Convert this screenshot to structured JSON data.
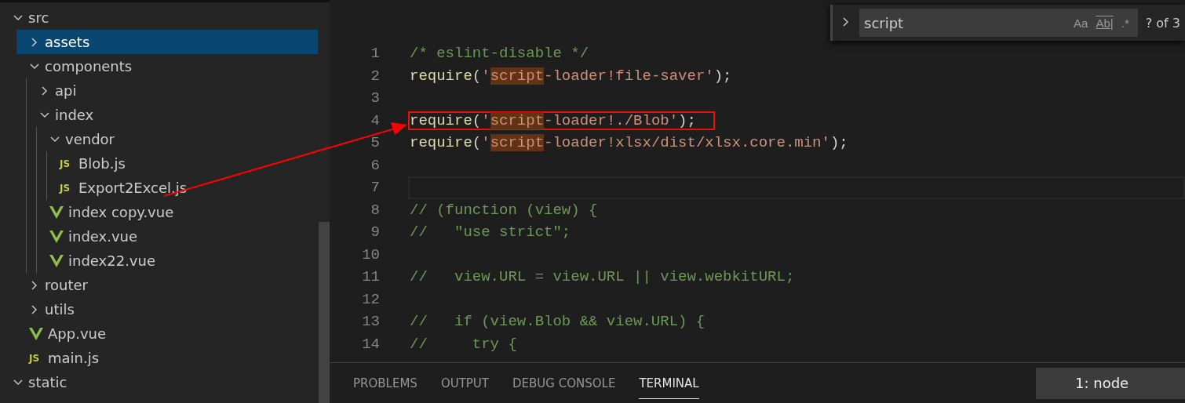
{
  "explorer": {
    "items": [
      {
        "name": "src",
        "kind": "folder",
        "expanded": true,
        "selected": false,
        "children": [
          {
            "name": "assets",
            "kind": "folder",
            "expanded": false,
            "selected": true
          },
          {
            "name": "components",
            "kind": "folder",
            "expanded": true,
            "selected": false,
            "children": [
              {
                "name": "api",
                "kind": "folder",
                "expanded": false,
                "selected": false
              },
              {
                "name": "index",
                "kind": "folder",
                "expanded": true,
                "selected": false,
                "children": [
                  {
                    "name": "vendor",
                    "kind": "folder",
                    "expanded": true,
                    "selected": false,
                    "children": [
                      {
                        "name": "Blob.js",
                        "kind": "js",
                        "icon_label": "JS",
                        "selected": false
                      },
                      {
                        "name": "Export2Excel.js",
                        "kind": "js",
                        "icon_label": "JS",
                        "selected": false
                      }
                    ]
                  },
                  {
                    "name": "index copy.vue",
                    "kind": "vue",
                    "selected": false
                  },
                  {
                    "name": "index.vue",
                    "kind": "vue",
                    "selected": false
                  },
                  {
                    "name": "index22.vue",
                    "kind": "vue",
                    "selected": false
                  }
                ]
              }
            ]
          },
          {
            "name": "router",
            "kind": "folder",
            "expanded": false,
            "selected": false
          },
          {
            "name": "utils",
            "kind": "folder",
            "expanded": false,
            "selected": false
          },
          {
            "name": "App.vue",
            "kind": "vue",
            "selected": false
          },
          {
            "name": "main.js",
            "kind": "js",
            "icon_label": "JS",
            "selected": false
          }
        ]
      },
      {
        "name": "static",
        "kind": "folder",
        "expanded": true,
        "selected": false
      }
    ]
  },
  "find_widget": {
    "value": "script",
    "options": [
      "Aa",
      "Ab|",
      ".*"
    ],
    "count": "? of 3"
  },
  "editor": {
    "lines": [
      {
        "number": "1",
        "tokens": [
          {
            "text": "/* eslint-disable */",
            "kind": "comment"
          }
        ]
      },
      {
        "number": "2",
        "tokens": [
          {
            "text": "require",
            "kind": "func"
          },
          {
            "text": "(",
            "kind": "punct"
          },
          {
            "text": "'",
            "kind": "string"
          },
          {
            "text": "script",
            "kind": "match"
          },
          {
            "text": "-loader!file-saver'",
            "kind": "string"
          },
          {
            "text": ");",
            "kind": "punct"
          }
        ]
      },
      {
        "number": "3"
      },
      {
        "number": "4",
        "boxed": true,
        "tokens": [
          {
            "text": "require",
            "kind": "func"
          },
          {
            "text": "(",
            "kind": "punct"
          },
          {
            "text": "'",
            "kind": "string"
          },
          {
            "text": "script",
            "kind": "match"
          },
          {
            "text": "-loader!./Blob'",
            "kind": "string"
          },
          {
            "text": ");",
            "kind": "punct"
          }
        ]
      },
      {
        "number": "5",
        "tokens": [
          {
            "text": "require",
            "kind": "func"
          },
          {
            "text": "(",
            "kind": "punct"
          },
          {
            "text": "'",
            "kind": "string"
          },
          {
            "text": "script",
            "kind": "match"
          },
          {
            "text": "-loader!xlsx/dist/xlsx.core.min'",
            "kind": "string"
          },
          {
            "text": ");",
            "kind": "punct"
          }
        ]
      },
      {
        "number": "6"
      },
      {
        "number": "7",
        "current": true
      },
      {
        "number": "8",
        "tokens": [
          {
            "text": "// (function (view) {",
            "kind": "comment"
          }
        ]
      },
      {
        "number": "9",
        "tokens": [
          {
            "text": "//   \"use strict\";",
            "kind": "comment"
          }
        ]
      },
      {
        "number": "10"
      },
      {
        "number": "11",
        "tokens": [
          {
            "text": "//   view.URL = view.URL || view.webkitURL;",
            "kind": "comment"
          }
        ]
      },
      {
        "number": "12"
      },
      {
        "number": "13",
        "tokens": [
          {
            "text": "//   if (view.Blob && view.URL) {",
            "kind": "comment"
          }
        ]
      },
      {
        "number": "14",
        "tokens": [
          {
            "text": "//     try {",
            "kind": "comment"
          }
        ]
      }
    ]
  },
  "panel": {
    "tabs": [
      {
        "label": "PROBLEMS",
        "selected": false
      },
      {
        "label": "OUTPUT",
        "selected": false
      },
      {
        "label": "DEBUG CONSOLE",
        "selected": false
      },
      {
        "label": "TERMINAL",
        "selected": true
      }
    ],
    "terminal": "1: node"
  }
}
